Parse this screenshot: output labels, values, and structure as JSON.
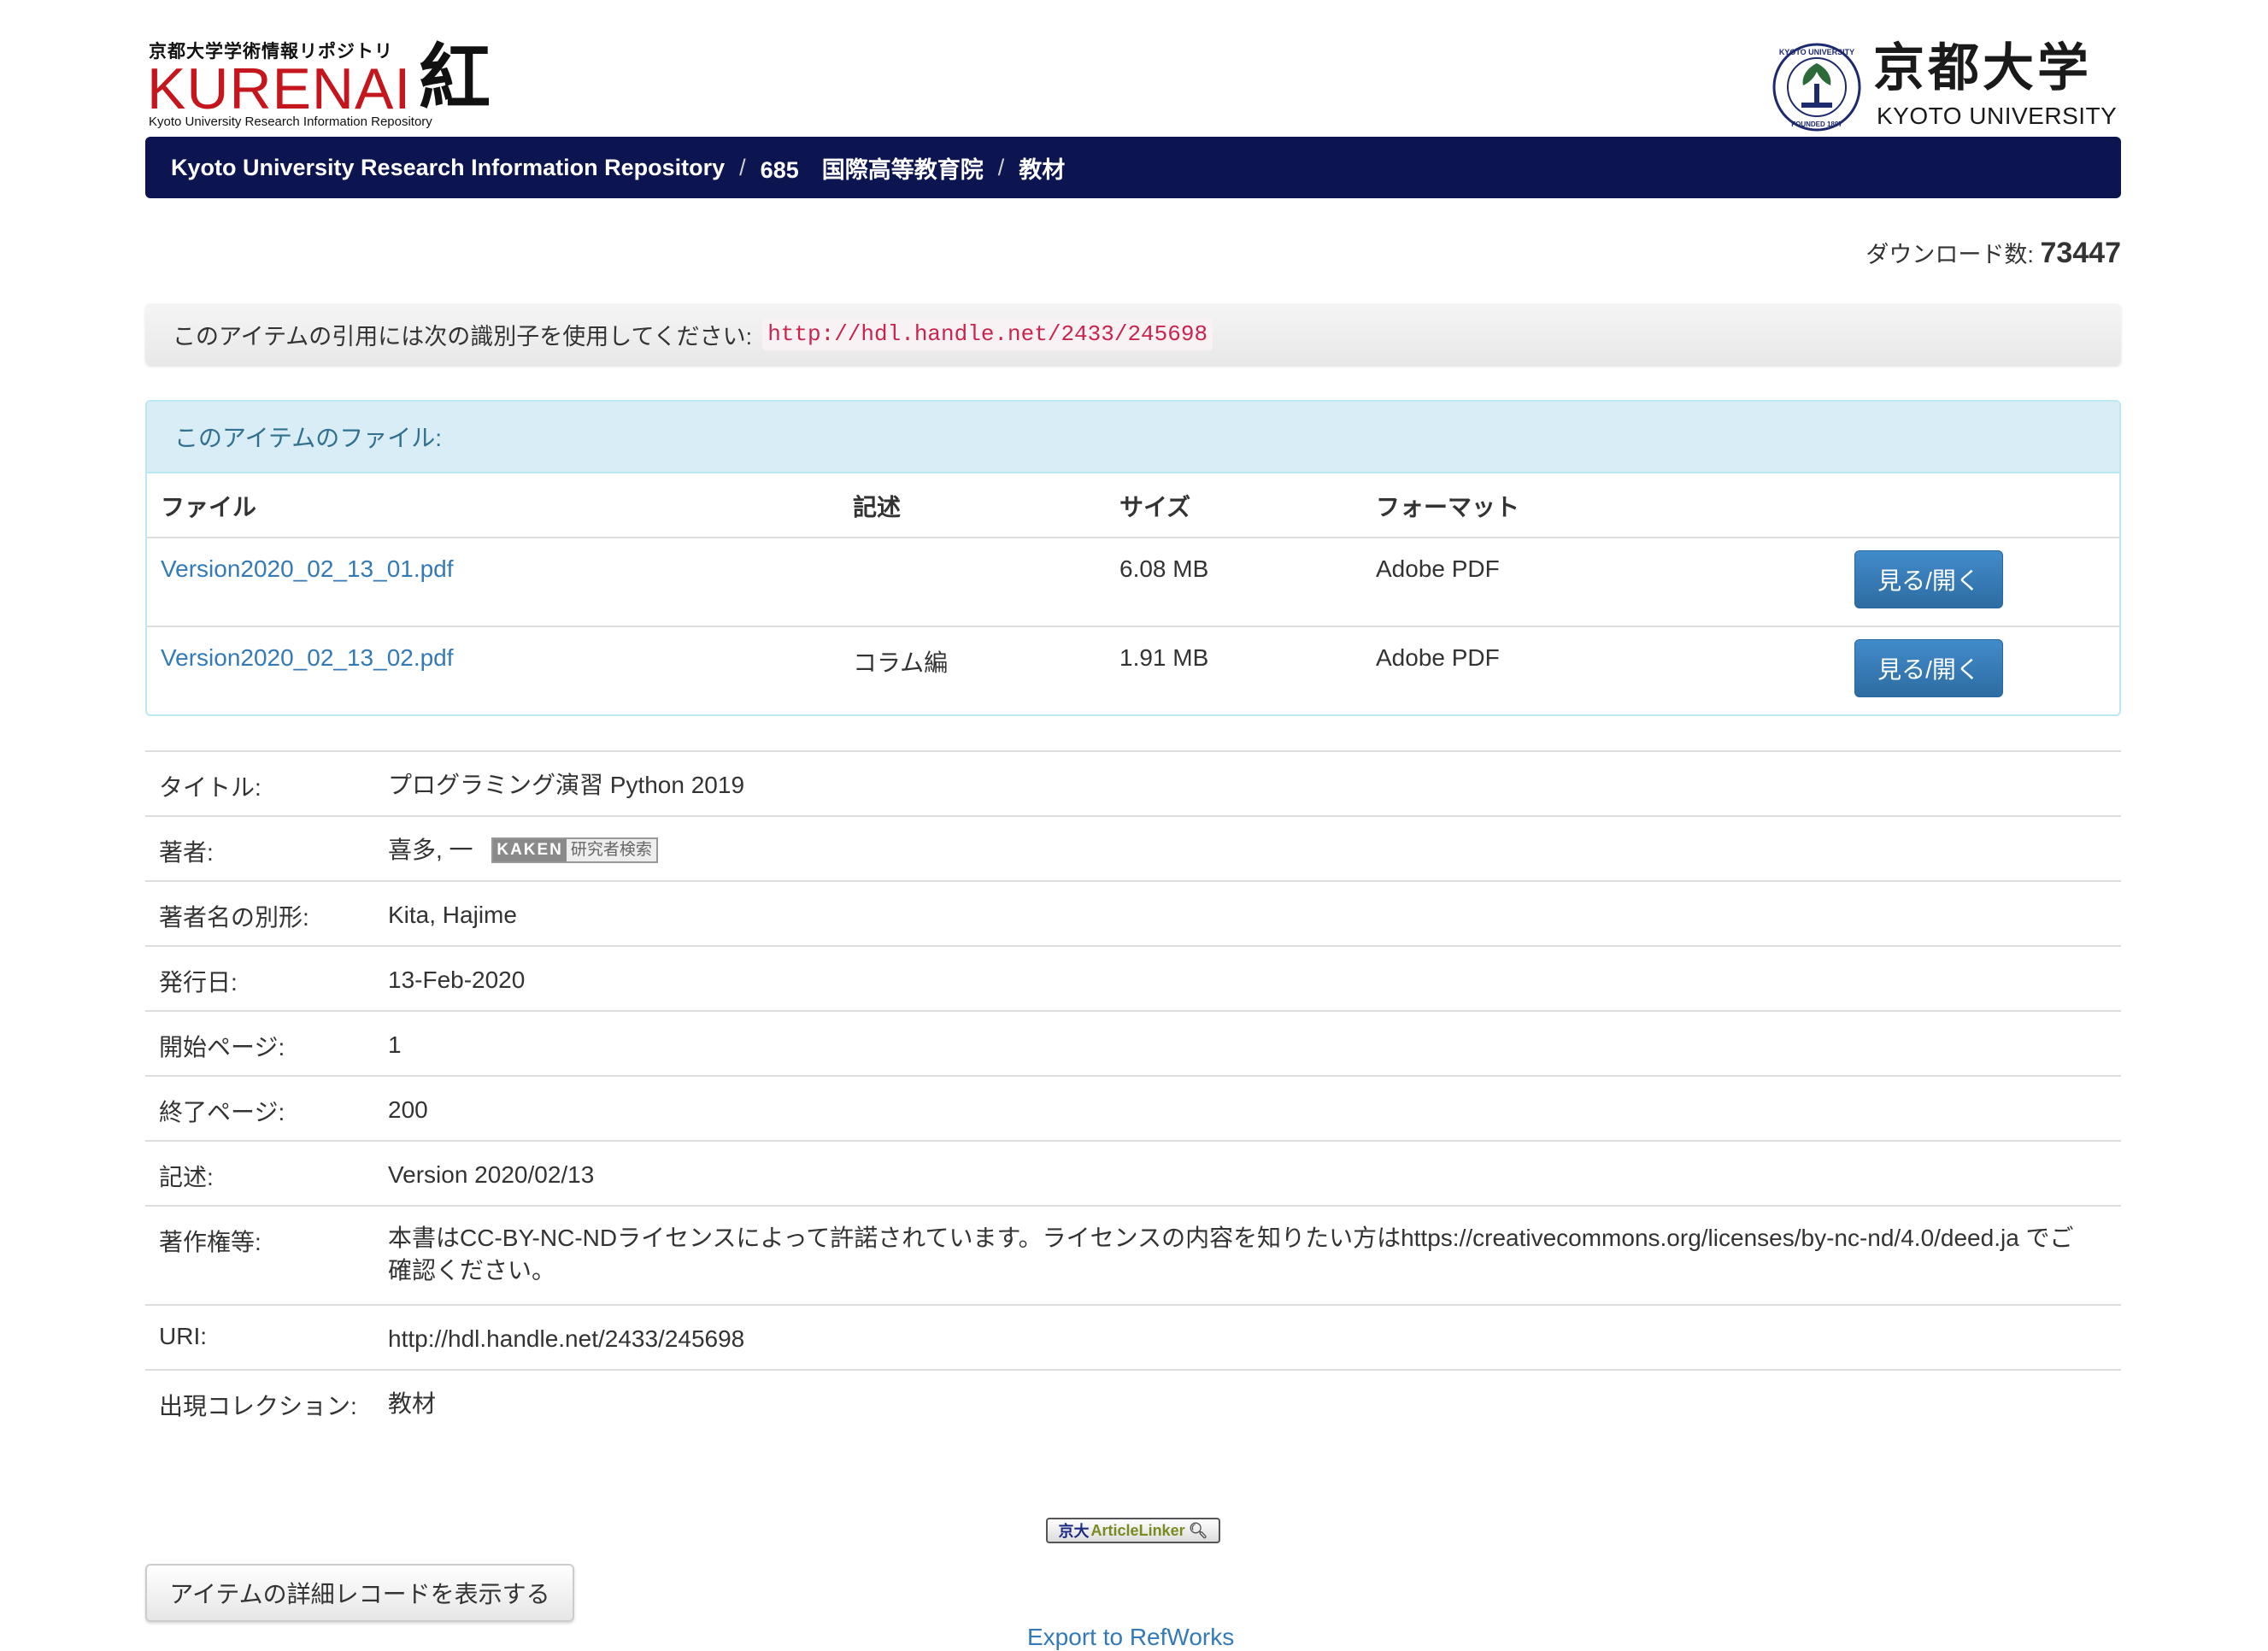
{
  "header": {
    "logo_left": {
      "subtitle_jp": "京都大学学術情報リポジトリ",
      "wordmark": "KURENAI",
      "kanji": "紅",
      "subtitle_en": "Kyoto University Research Information Repository"
    },
    "logo_right": {
      "name_jp": "京都大学",
      "name_en": "KYOTO UNIVERSITY",
      "seal_text_top": "KYOTO UNIVERSITY",
      "seal_text_bottom": "FOUNDED 1897"
    }
  },
  "breadcrumb": {
    "items": [
      "Kyoto University Research Information Repository",
      "685　国際高等教育院",
      "教材"
    ],
    "separator": "/"
  },
  "downloads": {
    "label": "ダウンロード数:",
    "count": "73447"
  },
  "citation": {
    "label": "このアイテムの引用には次の識別子を使用してください:",
    "handle": "http://hdl.handle.net/2433/245698"
  },
  "files": {
    "panel_title": "このアイテムのファイル:",
    "columns": [
      "ファイル",
      "記述",
      "サイズ",
      "フォーマット"
    ],
    "rows": [
      {
        "file": "Version2020_02_13_01.pdf",
        "description": "",
        "size": "6.08 MB",
        "format": "Adobe PDF",
        "action": "見る/開く"
      },
      {
        "file": "Version2020_02_13_02.pdf",
        "description": "コラム編",
        "size": "1.91 MB",
        "format": "Adobe PDF",
        "action": "見る/開く"
      }
    ]
  },
  "metadata": {
    "title": {
      "label": "タイトル:",
      "value": "プログラミング演習 Python 2019"
    },
    "author": {
      "label": "著者:",
      "value": "喜多, 一",
      "kaken_left": "KAKEN",
      "kaken_right": "研究者検索"
    },
    "author_alt": {
      "label": "著者名の別形:",
      "value": "Kita, Hajime"
    },
    "issued": {
      "label": "発行日:",
      "value": "13-Feb-2020"
    },
    "start_page": {
      "label": "開始ページ:",
      "value": "1"
    },
    "end_page": {
      "label": "終了ページ:",
      "value": "200"
    },
    "description": {
      "label": "記述:",
      "value": "Version 2020/02/13"
    },
    "rights": {
      "label": "著作権等:",
      "value": "本書はCC-BY-NC-NDライセンスによって許諾されています。ライセンスの内容を知りたい方はhttps://creativecommons.org/licenses/by-nc-nd/4.0/deed.ja でご確認ください。"
    },
    "uri": {
      "label": "URI:",
      "value": "http://hdl.handle.net/2433/245698"
    },
    "collection": {
      "label": "出現コレクション:",
      "value": "教材"
    }
  },
  "footer": {
    "article_linker": {
      "part1": "京大",
      "part2": "ArticleLinker"
    },
    "detail_button": "アイテムの詳細レコードを表示する",
    "export_link": "Export to RefWorks"
  },
  "colors": {
    "breadcrumb_bg": "#0d1550",
    "logo_red": "#c4161c",
    "link": "#337ab7",
    "panel_head_bg": "#d9edf7",
    "button_primary": "#428bca",
    "code_text": "#c7254e"
  }
}
